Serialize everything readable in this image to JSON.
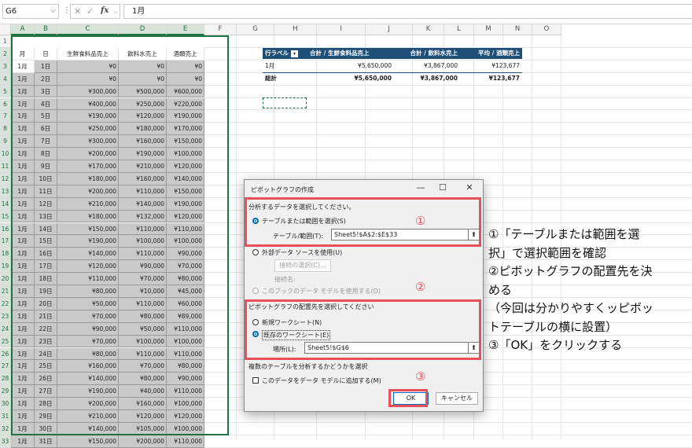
{
  "formula_bar": {
    "name_box": "G6",
    "formula": "1月",
    "fx": "fx"
  },
  "columns": [
    "A",
    "B",
    "C",
    "D",
    "E",
    "F",
    "G",
    "H",
    "I",
    "J",
    "K",
    "L",
    "M",
    "N",
    "O"
  ],
  "rows": [
    "1",
    "2",
    "3",
    "4",
    "5",
    "6",
    "7",
    "8",
    "9",
    "10",
    "11",
    "12",
    "13",
    "14",
    "15",
    "16",
    "17",
    "18",
    "19",
    "20",
    "21",
    "22",
    "23",
    "24",
    "25",
    "26",
    "27",
    "28",
    "29",
    "30",
    "31",
    "32",
    "33"
  ],
  "table": {
    "headers": [
      "月",
      "日",
      "生鮮食料品売上",
      "飲料水売上",
      "酒類売上"
    ],
    "rows": [
      [
        "1月",
        "1日",
        "¥0",
        "¥0",
        "¥0"
      ],
      [
        "1月",
        "2日",
        "¥0",
        "¥0",
        "¥0"
      ],
      [
        "1月",
        "3日",
        "¥300,000",
        "¥500,000",
        "¥600,000"
      ],
      [
        "1月",
        "4日",
        "¥400,000",
        "¥250,000",
        "¥220,000"
      ],
      [
        "1月",
        "5日",
        "¥190,000",
        "¥120,000",
        "¥190,000"
      ],
      [
        "1月",
        "6日",
        "¥250,000",
        "¥180,000",
        "¥170,000"
      ],
      [
        "1月",
        "7日",
        "¥300,000",
        "¥160,000",
        "¥150,000"
      ],
      [
        "1月",
        "8日",
        "¥200,000",
        "¥190,000",
        "¥100,000"
      ],
      [
        "1月",
        "9日",
        "¥170,000",
        "¥210,000",
        "¥120,000"
      ],
      [
        "1月",
        "10日",
        "¥180,000",
        "¥160,000",
        "¥140,000"
      ],
      [
        "1月",
        "11日",
        "¥200,000",
        "¥110,000",
        "¥150,000"
      ],
      [
        "1月",
        "12日",
        "¥210,000",
        "¥140,000",
        "¥190,000"
      ],
      [
        "1月",
        "13日",
        "¥180,000",
        "¥132,000",
        "¥120,000"
      ],
      [
        "1月",
        "14日",
        "¥150,000",
        "¥110,000",
        "¥110,000"
      ],
      [
        "1月",
        "15日",
        "¥190,000",
        "¥100,000",
        "¥100,000"
      ],
      [
        "1月",
        "16日",
        "¥140,000",
        "¥110,000",
        "¥90,000"
      ],
      [
        "1月",
        "17日",
        "¥120,000",
        "¥90,000",
        "¥70,000"
      ],
      [
        "1月",
        "18日",
        "¥110,000",
        "¥70,000",
        "¥80,000"
      ],
      [
        "1月",
        "19日",
        "¥80,000",
        "¥10,000",
        "¥45,000"
      ],
      [
        "1月",
        "20日",
        "¥50,000",
        "¥110,000",
        "¥60,000"
      ],
      [
        "1月",
        "21日",
        "¥70,000",
        "¥80,000",
        "¥89,000"
      ],
      [
        "1月",
        "22日",
        "¥90,000",
        "¥50,000",
        "¥110,000"
      ],
      [
        "1月",
        "23日",
        "¥70,000",
        "¥100,000",
        "¥100,000"
      ],
      [
        "1月",
        "24日",
        "¥80,000",
        "¥110,000",
        "¥110,000"
      ],
      [
        "1月",
        "25日",
        "¥160,000",
        "¥70,000",
        "¥80,000"
      ],
      [
        "1月",
        "26日",
        "¥140,000",
        "¥80,000",
        "¥90,000"
      ],
      [
        "1月",
        "27日",
        "¥190,000",
        "¥40,000",
        "¥110,000"
      ],
      [
        "1月",
        "28日",
        "¥200,000",
        "¥160,000",
        "¥100,000"
      ],
      [
        "1月",
        "29日",
        "¥210,000",
        "¥120,000",
        "¥120,000"
      ],
      [
        "1月",
        "30日",
        "¥140,000",
        "¥105,000",
        "¥100,000"
      ],
      [
        "1月",
        "31日",
        "¥150,000",
        "¥200,000",
        "¥110,000"
      ]
    ]
  },
  "pivot": {
    "headers": [
      "行ラベル",
      "合計 / 生鮮食料品売上",
      "合計 / 飲料水売上",
      "平均 / 酒類売上"
    ],
    "row": [
      "1月",
      "¥5,650,000",
      "¥3,867,000",
      "¥123,677"
    ],
    "total": [
      "総計",
      "¥5,650,000",
      "¥3,867,000",
      "¥123,677"
    ]
  },
  "dialog": {
    "title": "ピボットグラフの作成",
    "section1": "分析するデータを選択してください。",
    "opt_table": "テーブルまたは範囲を選択(S)",
    "range_label": "テーブル/範囲(T):",
    "range_value": "Sheet5!$A$2:$E$33",
    "opt_external": "外部データ ソースを使用(U)",
    "conn_button": "接続の選択(C)...",
    "conn_name": "接続名:",
    "opt_model": "このブックのデータ モデルを使用する(D)",
    "section2": "ピボットグラフの配置先を選択してください",
    "opt_new": "新規ワークシート(N)",
    "opt_existing": "既存のワークシート(E)",
    "loc_label": "場所(L):",
    "loc_value": "Sheet5!$G$6",
    "section3": "複数のテーブルを分析するかどうかを選択",
    "chk_model": "このデータをデータ モデルに追加する(M)",
    "ok": "OK",
    "cancel": "キャンセル",
    "minimize": "—",
    "maximize": "☐",
    "close": "✕",
    "pick": "⬆"
  },
  "callouts": {
    "c1": "①",
    "c2": "②",
    "c3": "③"
  },
  "notes": [
    "①「テーブルまたは範囲を選",
    "択」で選択範囲を確認",
    "②ピボットグラフの配置先を決",
    "める",
    "（今回は分かりやすくッピボッ",
    "トテーブルの横に設置）",
    "③「OK」をクリックする"
  ],
  "colors": {
    "accent": "#217346",
    "pivot_header": "#1f4e79",
    "callout": "#e9505a",
    "selection": "#c9c9c9"
  }
}
